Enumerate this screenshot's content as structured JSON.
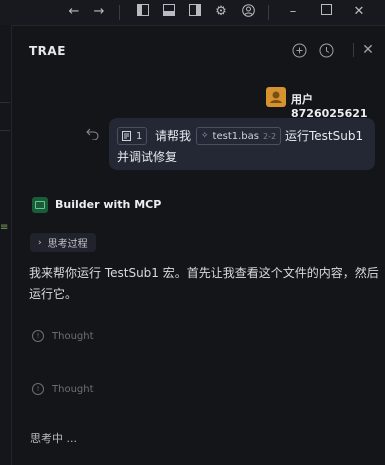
{
  "panel": {
    "title": "TRAE"
  },
  "user": {
    "name": "用户8726025621"
  },
  "message": {
    "chip_count": "1",
    "ask": "请帮我",
    "file_chip": "test1.bas",
    "file_range": "2-2",
    "run": "运行TestSub1",
    "fix": "并调试修复"
  },
  "assistant": {
    "name": "Builder with MCP",
    "think_toggle": "思考过程",
    "reply": "我来帮你运行 TestSub1 宏。首先让我查看这个文件的内容，然后运行它。",
    "thoughts": [
      "Thought",
      "Thought"
    ],
    "status": "思考中 ..."
  },
  "colors": {
    "avatar": "#d6922f",
    "bubble": "#232834",
    "builder_icon": "#4fd18b"
  }
}
